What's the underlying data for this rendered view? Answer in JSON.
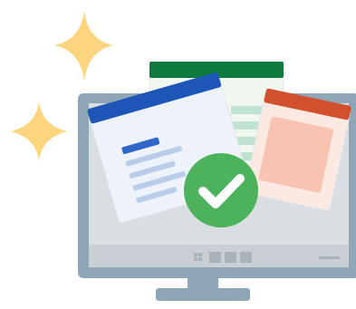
{
  "illustration": {
    "colors": {
      "sparkle": "#FCD57E",
      "monitor_frame": "#8FA6B6",
      "monitor_screen": "#D9DEE2",
      "stand": "#8FA6B6",
      "taskbar": "#C9CFD4",
      "taskbar_tiles": "#A8B2BA",
      "word_header": "#1E56B8",
      "word_body": "#EEF2FA",
      "word_lines": "#B9CDEB",
      "word_title_bar": "#2E66C9",
      "excel_header": "#0E7A3D",
      "excel_body": "#EFF7EF",
      "excel_rows": "#BFE3CF",
      "ppt_header": "#D1512E",
      "ppt_body": "#FCEAE2",
      "ppt_panel": "#F8C3B0",
      "check_circle": "#4CB25C",
      "check_mark": "#FFFFFF"
    },
    "icons": {
      "sparkle_large": "sparkle-icon",
      "sparkle_small": "sparkle-icon",
      "start_button": "windows-logo-icon",
      "success": "checkmark-icon"
    }
  }
}
